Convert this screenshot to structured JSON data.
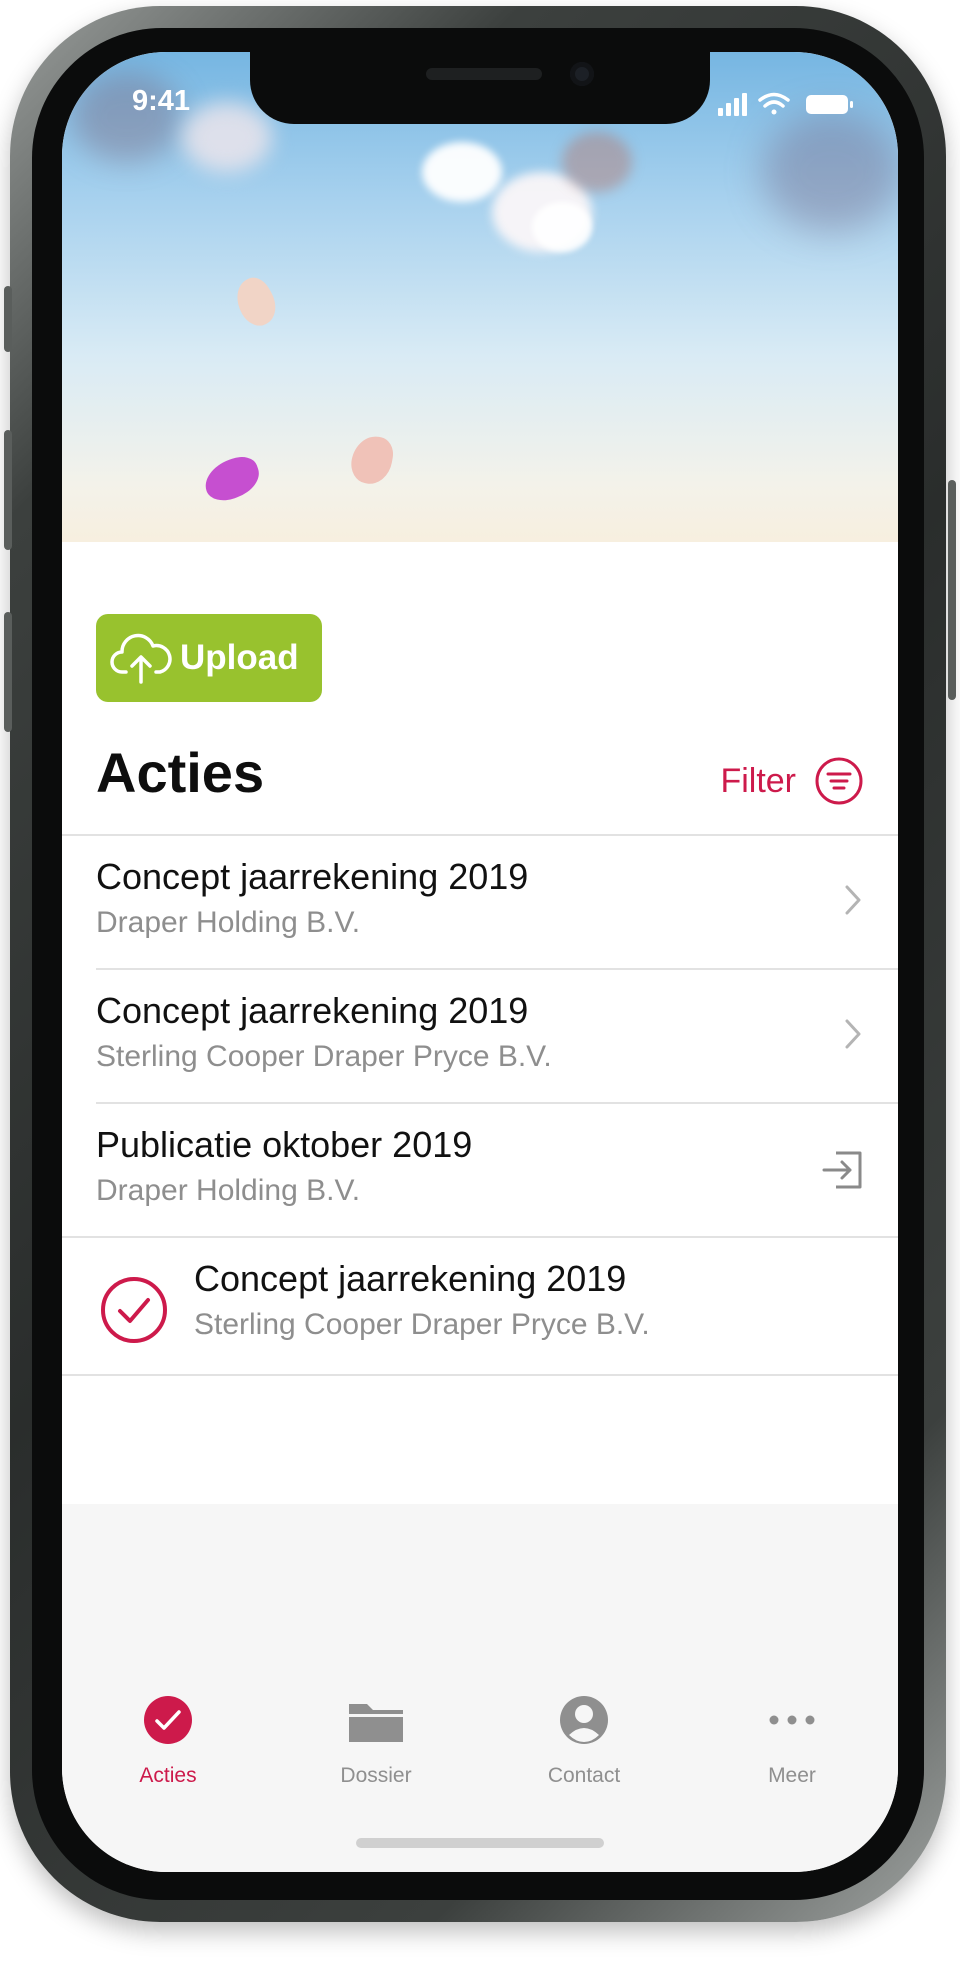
{
  "status_bar": {
    "time": "9:41"
  },
  "upload_button": {
    "label": "Upload",
    "icon": "cloud-upload-icon"
  },
  "actions": {
    "title": "Acties",
    "filter_label": "Filter",
    "items": [
      {
        "title": "Concept jaarrekening 2019",
        "subtitle": "Draper Holding B.V.",
        "trailing_icon": "chevron-right-icon"
      },
      {
        "title": "Concept jaarrekening 2019",
        "subtitle": "Sterling Cooper Draper Pryce B.V.",
        "trailing_icon": "chevron-right-icon"
      },
      {
        "title": "Publicatie oktober 2019",
        "subtitle": "Draper Holding B.V.",
        "trailing_icon": "sign-in-icon"
      },
      {
        "title": "Concept jaarrekening 2019",
        "subtitle": "Sterling Cooper Draper Pryce B.V.",
        "leading_icon": "checkmark-circle-icon",
        "completed": true
      }
    ]
  },
  "tab_bar": {
    "tabs": [
      {
        "label": "Acties",
        "icon": "check-circle-icon",
        "active": true
      },
      {
        "label": "Dossier",
        "icon": "folder-icon",
        "active": false
      },
      {
        "label": "Contact",
        "icon": "person-circle-icon",
        "active": false
      },
      {
        "label": "Meer",
        "icon": "more-dots-icon",
        "active": false
      }
    ]
  },
  "colors": {
    "accent": "#cd1a4b",
    "upload_green": "#98c22e",
    "secondary_text": "#8e8e8e",
    "tab_inactive": "#8f8f8f"
  }
}
